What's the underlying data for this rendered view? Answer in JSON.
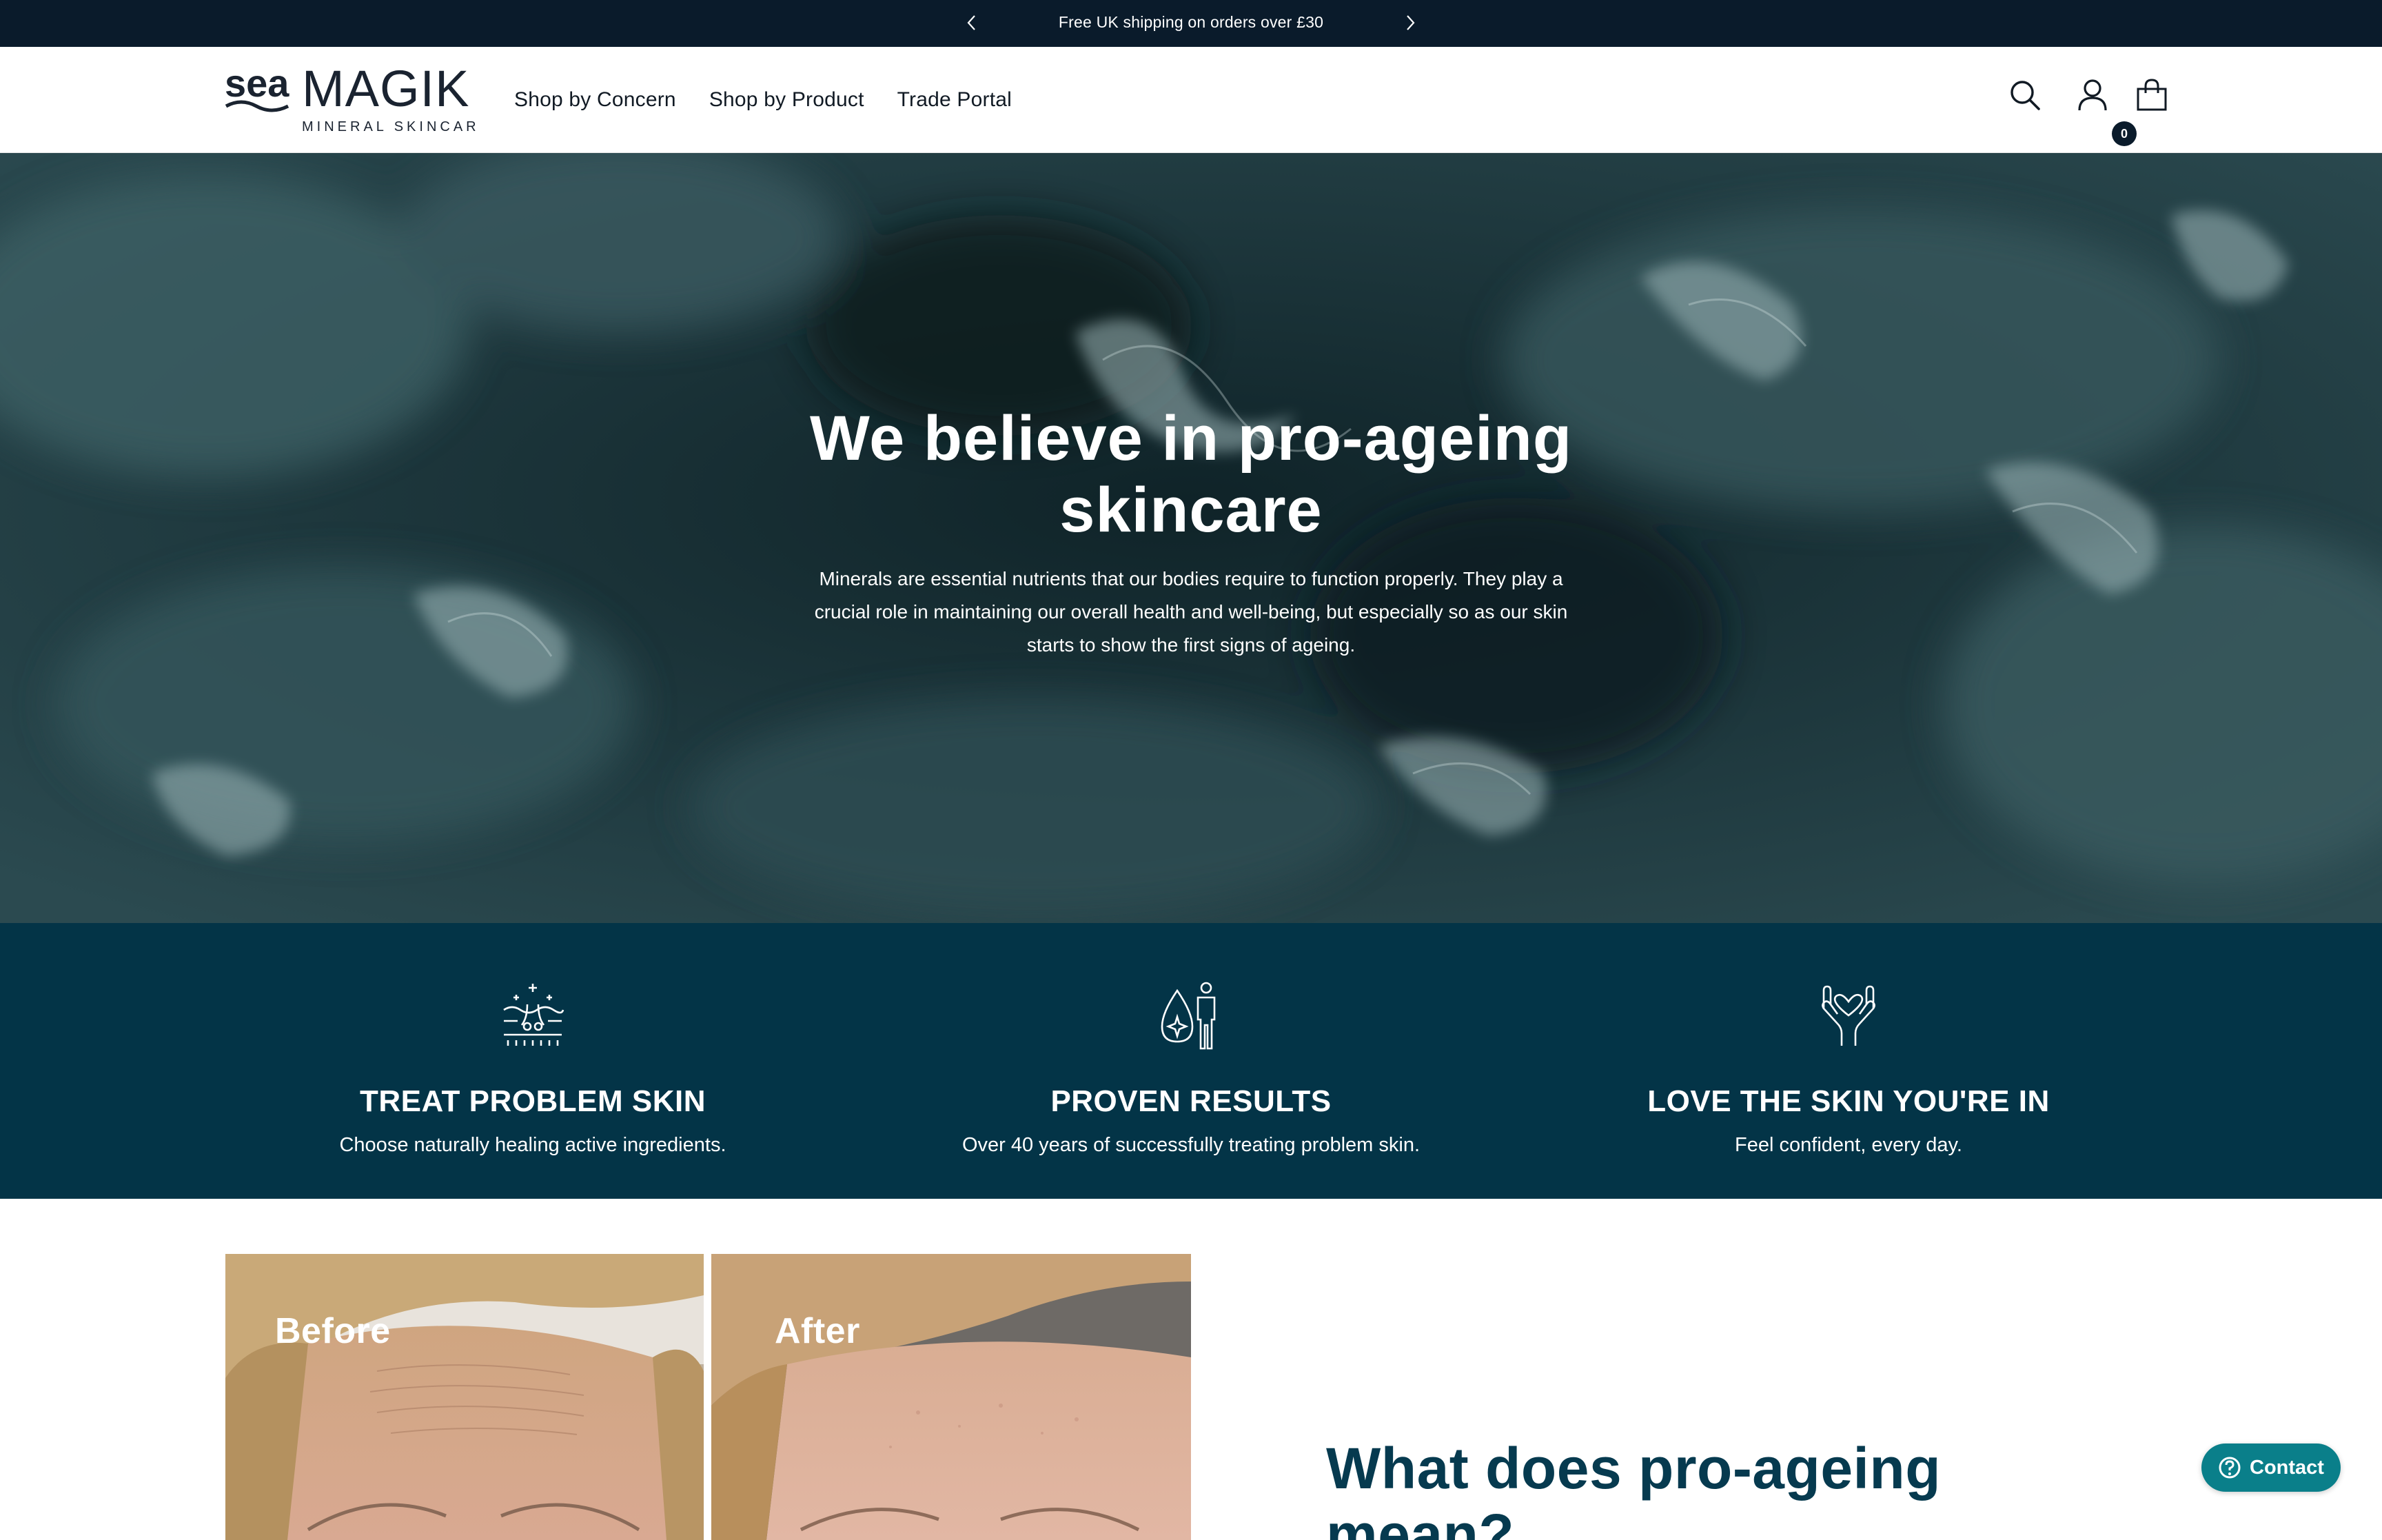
{
  "announcement": {
    "text": "Free UK shipping on orders over £30",
    "prev_icon": "chevron-left-icon",
    "next_icon": "chevron-right-icon"
  },
  "header": {
    "logo": {
      "wordmark_top": "sea",
      "wordmark_main": "MAGIK",
      "wordmark_sub": "MINERAL SKINCARE"
    },
    "nav": [
      {
        "label": "Shop by Concern"
      },
      {
        "label": "Shop by Product"
      },
      {
        "label": "Trade Portal"
      }
    ],
    "icons": [
      "search-icon",
      "account-icon",
      "cart-icon"
    ],
    "cart_count": "0"
  },
  "hero": {
    "title": "We believe in pro-ageing skincare",
    "text": "Minerals are essential nutrients that our bodies require to function properly. They play a crucial role in maintaining our overall health and well-being, but especially so as our skin starts to show the first signs of ageing."
  },
  "features": [
    {
      "icon": "skin-layers-icon",
      "title": "TREAT PROBLEM SKIN",
      "desc": "Choose naturally healing active ingredients."
    },
    {
      "icon": "drop-person-icon",
      "title": "PROVEN RESULTS",
      "desc": "Over 40 years of successfully treating problem skin."
    },
    {
      "icon": "hands-heart-icon",
      "title": "LOVE THE SKIN YOU'RE IN",
      "desc": "Feel confident, every day."
    }
  ],
  "before_after": {
    "before_label": "Before",
    "after_label": "After"
  },
  "pro_ageing": {
    "heading": "What does pro-ageing mean?"
  },
  "contact": {
    "label": "Contact",
    "icon": "help-circle-icon"
  },
  "colors": {
    "announcement_bg": "#0a1b2b",
    "features_bg": "#033447",
    "heading_teal": "#063a4f",
    "contact_bg": "#0a7f8a"
  }
}
